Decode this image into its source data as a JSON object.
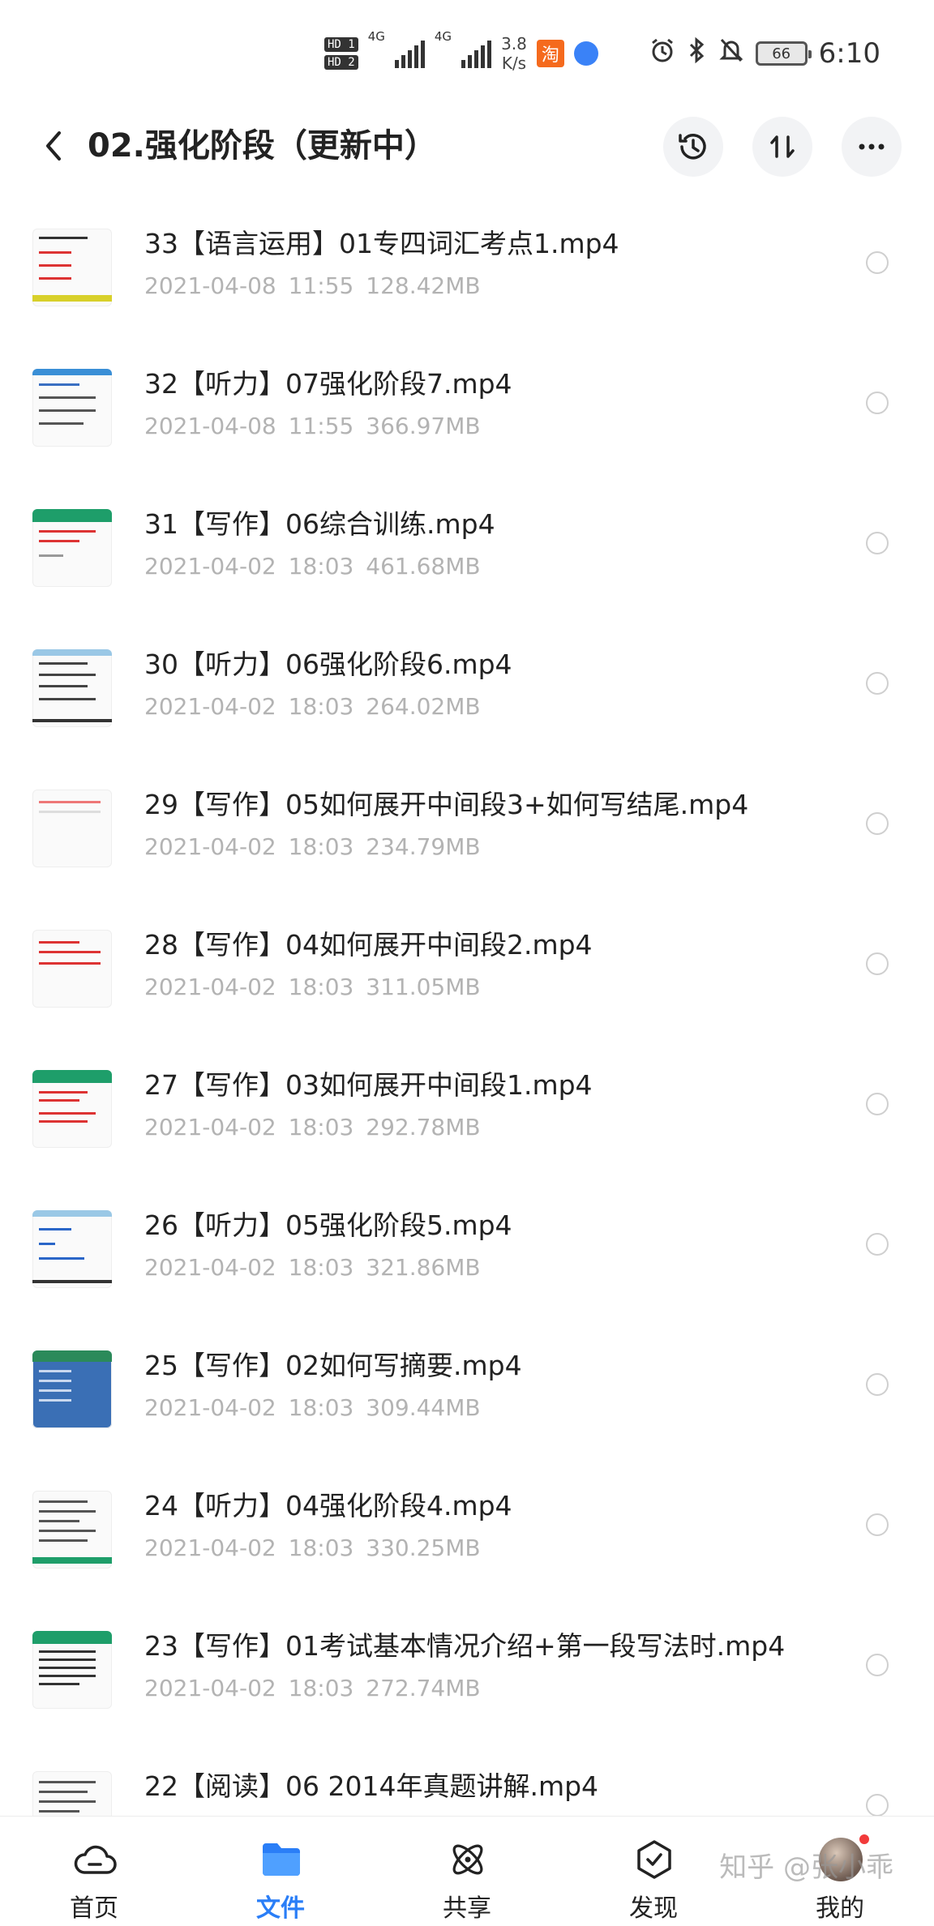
{
  "status_bar": {
    "hd1": "HD 1",
    "hd2": "HD 2",
    "net1": "4G",
    "net2": "4G",
    "speed_value": "3.8",
    "speed_unit": "K/s",
    "taobao_label": "淘",
    "battery": "66",
    "time": "6:10"
  },
  "header": {
    "title": "02.强化阶段（更新中）"
  },
  "files": [
    {
      "name": "33【语言运用】01专四词汇考点1.mp4",
      "date": "2021-04-08",
      "time": "11:55",
      "size": "128.42MB"
    },
    {
      "name": "32【听力】07强化阶段7.mp4",
      "date": "2021-04-08",
      "time": "11:55",
      "size": "366.97MB"
    },
    {
      "name": "31【写作】06综合训练.mp4",
      "date": "2021-04-02",
      "time": "18:03",
      "size": "461.68MB"
    },
    {
      "name": "30【听力】06强化阶段6.mp4",
      "date": "2021-04-02",
      "time": "18:03",
      "size": "264.02MB"
    },
    {
      "name": "29【写作】05如何展开中间段3+如何写结尾.mp4",
      "date": "2021-04-02",
      "time": "18:03",
      "size": "234.79MB"
    },
    {
      "name": "28【写作】04如何展开中间段2.mp4",
      "date": "2021-04-02",
      "time": "18:03",
      "size": "311.05MB"
    },
    {
      "name": "27【写作】03如何展开中间段1.mp4",
      "date": "2021-04-02",
      "time": "18:03",
      "size": "292.78MB"
    },
    {
      "name": "26【听力】05强化阶段5.mp4",
      "date": "2021-04-02",
      "time": "18:03",
      "size": "321.86MB"
    },
    {
      "name": "25【写作】02如何写摘要.mp4",
      "date": "2021-04-02",
      "time": "18:03",
      "size": "309.44MB"
    },
    {
      "name": "24【听力】04强化阶段4.mp4",
      "date": "2021-04-02",
      "time": "18:03",
      "size": "330.25MB"
    },
    {
      "name": "23【写作】01考试基本情况介绍+第一段写法时.mp4",
      "date": "2021-04-02",
      "time": "18:03",
      "size": "272.74MB"
    },
    {
      "name": "22【阅读】06 2014年真题讲解.mp4",
      "date": "",
      "time": "",
      "size": ""
    }
  ],
  "bottom_nav": [
    {
      "label": "首页",
      "icon": "cloud-icon"
    },
    {
      "label": "文件",
      "icon": "folder-icon"
    },
    {
      "label": "共享",
      "icon": "atom-icon"
    },
    {
      "label": "发现",
      "icon": "discover-icon"
    },
    {
      "label": "我的",
      "icon": "avatar-icon"
    }
  ],
  "watermark": "知乎 @张小乖",
  "colors": {
    "accent": "#2a7ef7",
    "meta_text": "#b3b3b3",
    "header_button_bg": "#f2f3f5"
  }
}
